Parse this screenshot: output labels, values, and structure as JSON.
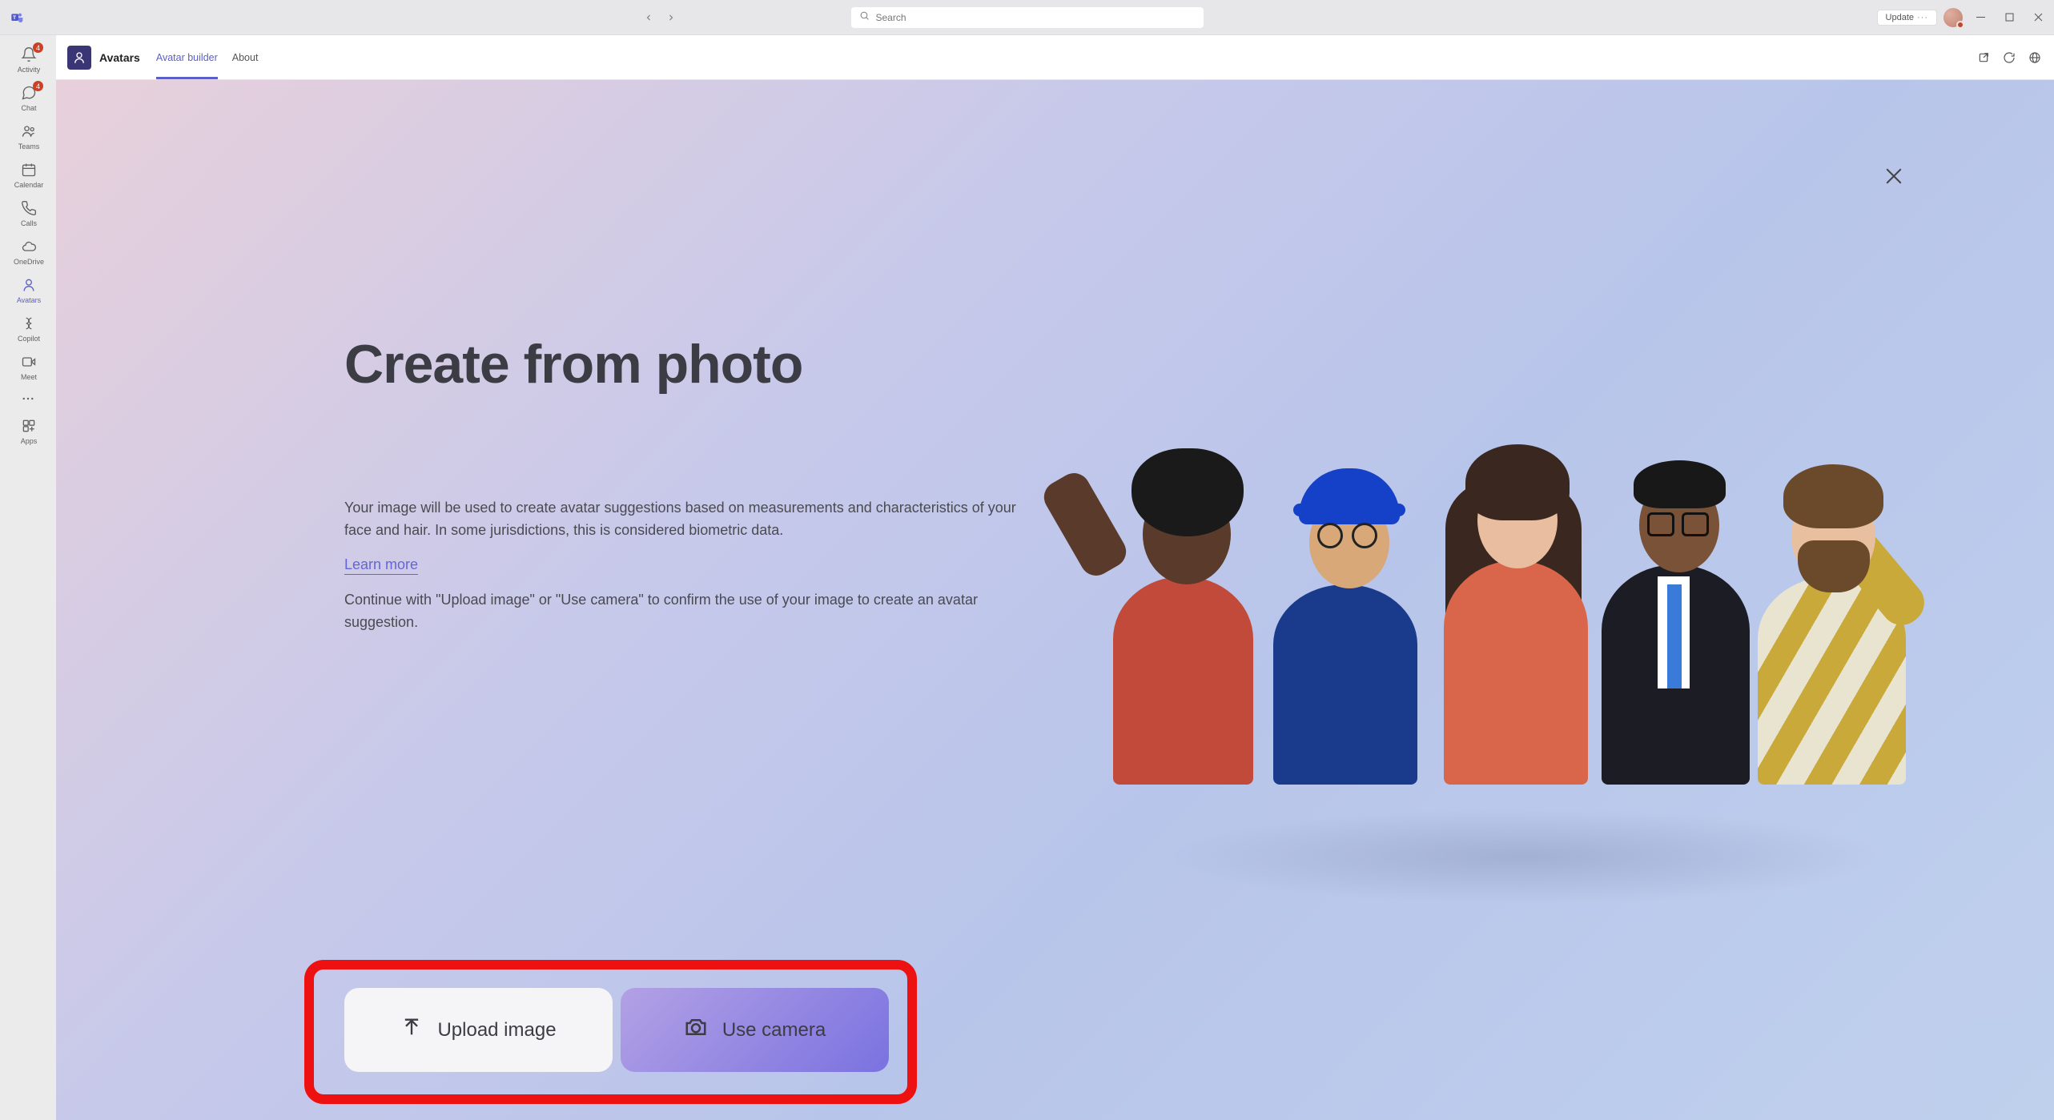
{
  "titlebar": {
    "search_placeholder": "Search",
    "update_label": "Update"
  },
  "rail": {
    "items": [
      {
        "label": "Activity",
        "badge": "4"
      },
      {
        "label": "Chat",
        "badge": "4"
      },
      {
        "label": "Teams",
        "badge": ""
      },
      {
        "label": "Calendar",
        "badge": ""
      },
      {
        "label": "Calls",
        "badge": ""
      },
      {
        "label": "OneDrive",
        "badge": ""
      },
      {
        "label": "Avatars",
        "badge": ""
      },
      {
        "label": "Copilot",
        "badge": ""
      },
      {
        "label": "Meet",
        "badge": ""
      }
    ],
    "apps_label": "Apps"
  },
  "app_header": {
    "title": "Avatars",
    "tabs": [
      {
        "label": "Avatar builder",
        "active": true
      },
      {
        "label": "About",
        "active": false
      }
    ]
  },
  "page": {
    "title": "Create from photo",
    "desc1": "Your image will be used to create avatar suggestions based on measurements and characteristics of your face and hair. In some jurisdictions, this is considered biometric data.",
    "learn_more": "Learn more",
    "desc2": "Continue with \"Upload image\" or \"Use camera\" to confirm the use of your image to create an avatar suggestion.",
    "upload_label": "Upload image",
    "camera_label": "Use camera"
  },
  "colors": {
    "accent": "#5b5fc7",
    "highlight": "#e11"
  }
}
